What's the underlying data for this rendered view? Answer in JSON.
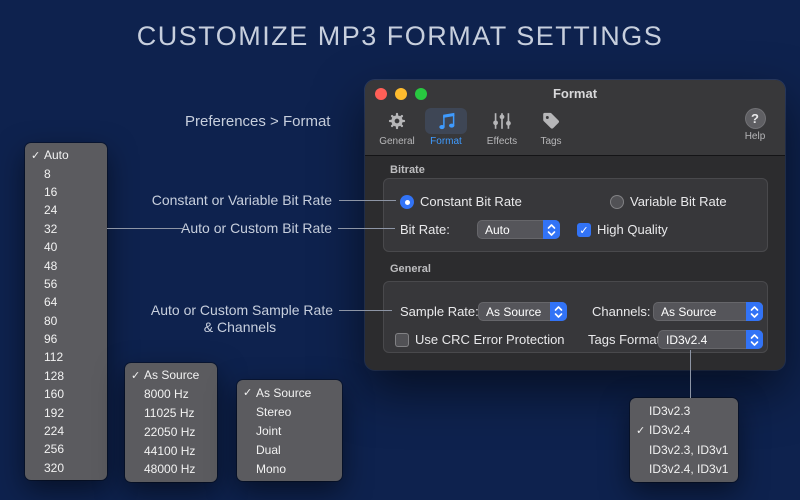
{
  "page": {
    "title": "CUSTOMIZE MP3 FORMAT SETTINGS",
    "breadcrumb": "Preferences > Format"
  },
  "annotations": {
    "bitrate_type": "Constant or Variable Bit Rate",
    "bitrate_auto": "Auto or Custom Bit Rate",
    "sample_rate_line1": "Auto or Custom Sample Rate",
    "sample_rate_line2": "& Channels"
  },
  "window": {
    "title": "Format",
    "toolbar": {
      "general": "General",
      "format": "Format",
      "effects": "Effects",
      "tags": "Tags",
      "help": "Help"
    },
    "bitrate": {
      "section_label": "Bitrate",
      "constant_radio": "Constant Bit Rate",
      "variable_radio": "Variable Bit Rate",
      "bit_rate_label": "Bit Rate:",
      "bit_rate_value": "Auto",
      "high_quality": "High Quality"
    },
    "general": {
      "section_label": "General",
      "sample_rate_label": "Sample Rate:",
      "sample_rate_value": "As Source",
      "channels_label": "Channels:",
      "channels_value": "As Source",
      "crc_checkbox": "Use CRC Error Protection",
      "tags_format_label": "Tags Format:",
      "tags_format_value": "ID3v2.4"
    }
  },
  "menus": {
    "bit_rate": {
      "checked": "Auto",
      "items": [
        "Auto",
        "8",
        "16",
        "24",
        "32",
        "40",
        "48",
        "56",
        "64",
        "80",
        "96",
        "112",
        "128",
        "160",
        "192",
        "224",
        "256",
        "320"
      ]
    },
    "sample_rate": {
      "checked": "As Source",
      "items": [
        "As Source",
        "8000 Hz",
        "11025 Hz",
        "22050 Hz",
        "44100 Hz",
        "48000 Hz"
      ]
    },
    "channels": {
      "checked": "As Source",
      "items": [
        "As Source",
        "Stereo",
        "Joint",
        "Dual",
        "Mono"
      ]
    },
    "tags_format": {
      "checked": "ID3v2.4",
      "items": [
        "ID3v2.3",
        "ID3v2.4",
        "ID3v2.3, ID3v1",
        "ID3v2.4, ID3v1"
      ]
    }
  },
  "icons": {
    "check": "✓",
    "help": "?"
  },
  "colors": {
    "background": "#0e224e",
    "accent_blue": "#3f9bff",
    "control_blue": "#3273f6",
    "menu_gray": "#5b5b5f",
    "traffic_red": "#ff5f57",
    "traffic_yellow": "#febc2e",
    "traffic_green": "#28c840"
  }
}
